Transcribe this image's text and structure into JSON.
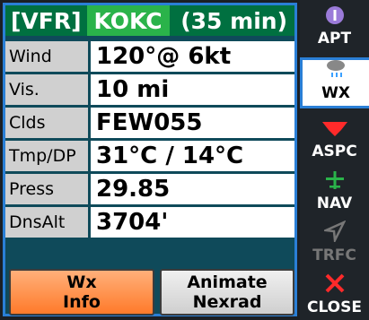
{
  "header": {
    "flight_rule": "[VFR]",
    "airport": "KOKC",
    "age": "(35 min)"
  },
  "rows": [
    {
      "label": "Wind",
      "value": "120°@ 6kt"
    },
    {
      "label": "Vis.",
      "value": "10 mi"
    },
    {
      "label": "Clds",
      "value": "FEW055"
    },
    {
      "label": "Tmp/DP",
      "value": "31°C / 14°C"
    },
    {
      "label": "Press",
      "value": "29.85"
    },
    {
      "label": "DnsAlt",
      "value": "3704'"
    }
  ],
  "buttons": {
    "wx_info_line1": "Wx",
    "wx_info_line2": "Info",
    "animate_line1": "Animate",
    "animate_line2": "Nexrad"
  },
  "sidebar": {
    "tabs": [
      {
        "label": "APT",
        "icon": "info-icon",
        "color": "#9b7bd9"
      },
      {
        "label": "WX",
        "icon": "cloud-rain-icon",
        "color": "#888888"
      },
      {
        "label": "ASPC",
        "icon": "airspace-icon",
        "color": "#ff2a2a"
      },
      {
        "label": "NAV",
        "icon": "airplane-icon",
        "color": "#2ab34a"
      },
      {
        "label": "TRFC",
        "icon": "traffic-arrow-icon",
        "color": "#777777"
      },
      {
        "label": "CLOSE",
        "icon": "close-icon",
        "color": "#ff2a2a"
      }
    ]
  }
}
